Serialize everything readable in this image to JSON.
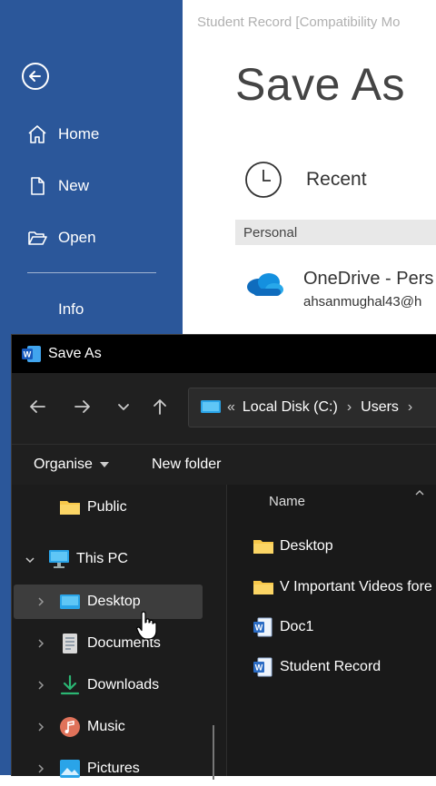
{
  "word": {
    "doc_title": "Student Record [Compatibility Mo",
    "page_title": "Save As",
    "nav": {
      "home": "Home",
      "new": "New",
      "open": "Open",
      "info": "Info"
    },
    "recent_label": "Recent",
    "personal_label": "Personal",
    "onedrive_name": "OneDrive - Pers",
    "onedrive_email": "ahsanmughal43@h"
  },
  "dialog": {
    "title": "Save As",
    "breadcrumb": {
      "sep": "«",
      "items": [
        "Local Disk (C:)",
        "Users"
      ]
    },
    "toolbar": {
      "organise": "Organise",
      "new_folder": "New folder"
    },
    "tree": {
      "public": "Public",
      "this_pc": "This PC",
      "desktop": "Desktop",
      "documents": "Documents",
      "downloads": "Downloads",
      "music": "Music",
      "pictures": "Pictures"
    },
    "column_name": "Name",
    "files": [
      {
        "name": "Desktop",
        "type": "folder"
      },
      {
        "name": "V Important Videos fore",
        "type": "folder"
      },
      {
        "name": "Doc1",
        "type": "word"
      },
      {
        "name": "Student Record",
        "type": "word"
      }
    ]
  },
  "colors": {
    "word_blue": "#2b579a",
    "dialog_bg": "#1c1c1c",
    "folder_yellow": "#f8c84a",
    "onedrive_blue": "#0f6cbd"
  }
}
